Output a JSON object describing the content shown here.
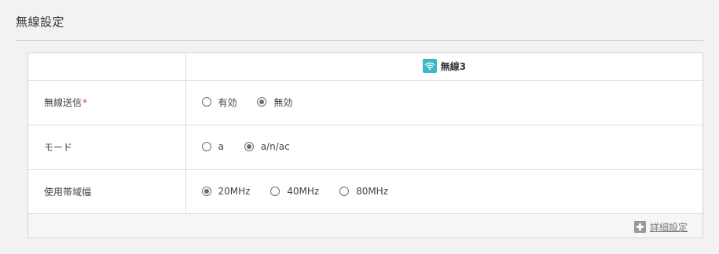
{
  "section": {
    "title": "無線設定"
  },
  "table": {
    "column_header": {
      "label": "無線3",
      "icon": "wifi-icon",
      "icon_color": "#3bb7c9"
    },
    "rows": [
      {
        "label": "無線送信",
        "required_mark": "*",
        "options": [
          {
            "label": "有効",
            "checked": false
          },
          {
            "label": "無効",
            "checked": true
          }
        ]
      },
      {
        "label": "モード",
        "options": [
          {
            "label": "a",
            "checked": false
          },
          {
            "label": "a/n/ac",
            "checked": true
          }
        ]
      },
      {
        "label": "使用帯域幅",
        "options": [
          {
            "label": "20MHz",
            "checked": true
          },
          {
            "label": "40MHz",
            "checked": false
          },
          {
            "label": "80MHz",
            "checked": false
          }
        ]
      }
    ]
  },
  "footer": {
    "detail_link_label": "詳細設定",
    "icon": "plus-icon"
  }
}
